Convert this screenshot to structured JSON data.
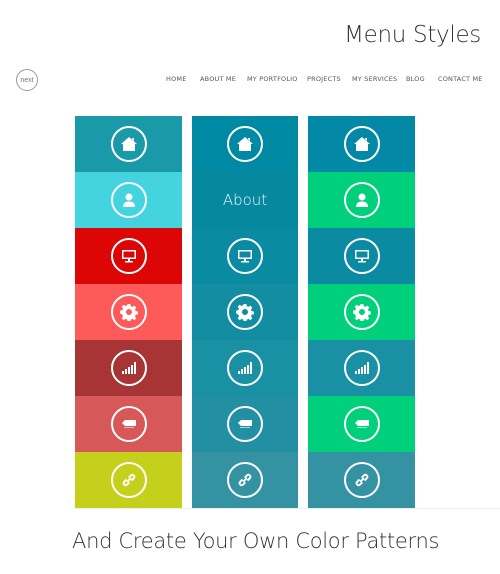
{
  "title": "Menu Styles",
  "logo": "next",
  "nav": [
    "HOME",
    "ABOUT ME",
    "MY PORTFOLIO",
    "PROJECTS",
    "MY SERVICES",
    "BLOG",
    "CONTACT ME"
  ],
  "icons": [
    "home-icon",
    "user-icon",
    "monitor-icon",
    "gear-icon",
    "signal-icon",
    "tag-icon",
    "link-icon"
  ],
  "menus": [
    {
      "colors": [
        "#1a9aa8",
        "#44d4df",
        "#dd0606",
        "#fe5a5a",
        "#a83535",
        "#d65858",
        "#c5d01c"
      ]
    },
    {
      "colors": [
        "#0089a3",
        "#06899f",
        "#0b8ba2",
        "#128da2",
        "#1a90a5",
        "#2290a2",
        "#3592a2"
      ],
      "hover_index": 1,
      "hover_label": "About"
    },
    {
      "colors": [
        "#0389a5",
        "#00cf7b",
        "#0b8ba2",
        "#00cf7b",
        "#1a90a5",
        "#00cf7b",
        "#3592a2"
      ]
    }
  ],
  "footer": "And Create Your Own Color Patterns"
}
